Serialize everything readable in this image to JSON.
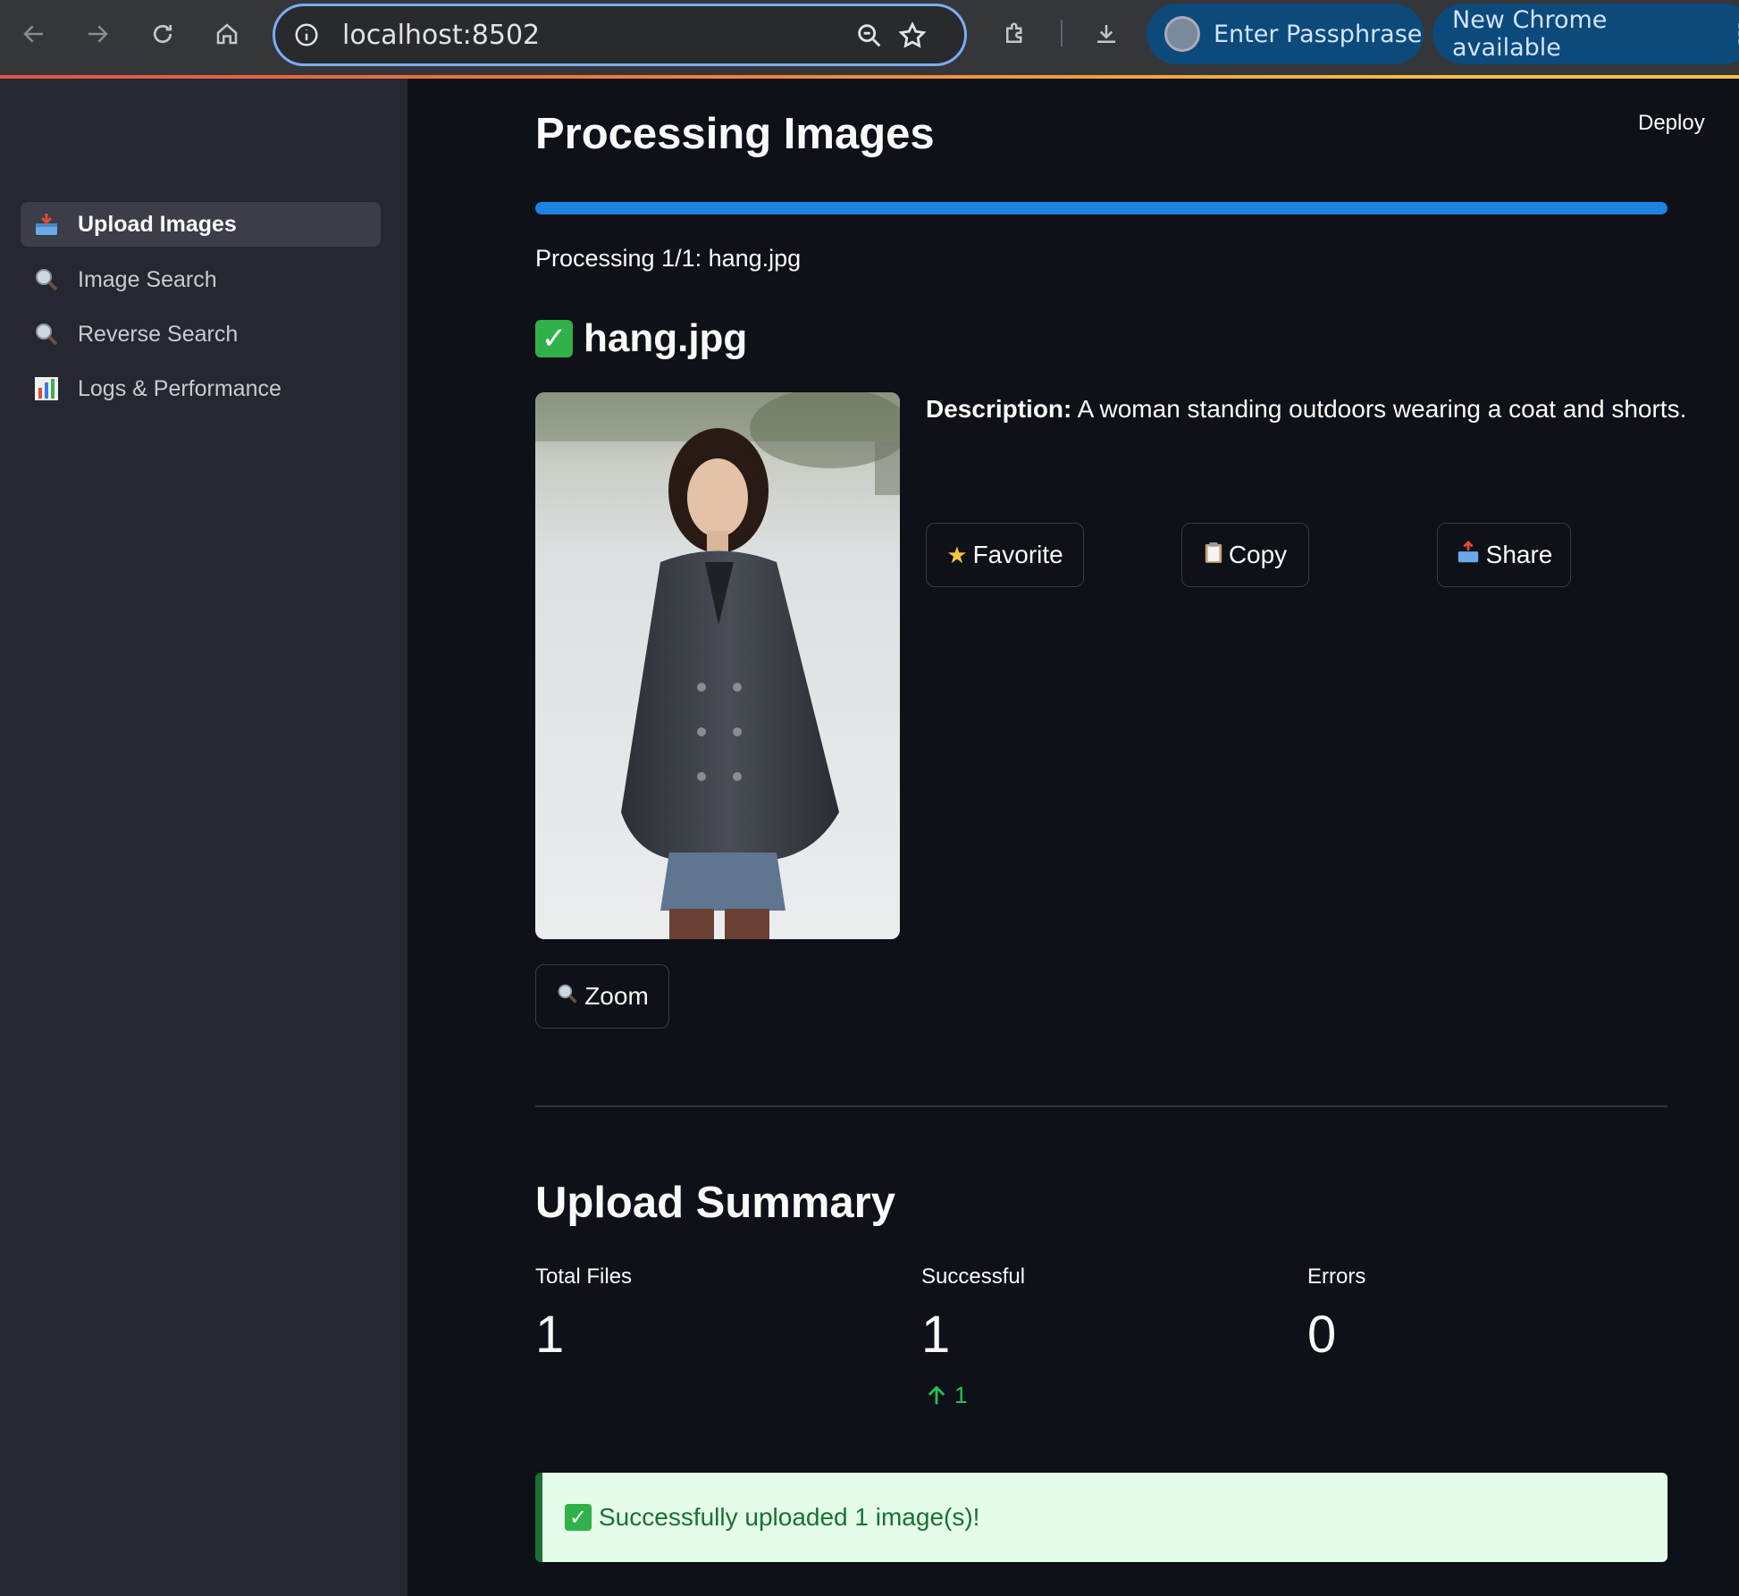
{
  "browser": {
    "url": "localhost:8502",
    "passphrase_label": "Enter Passphrase",
    "update_label": "New Chrome available"
  },
  "sidebar": {
    "items": [
      {
        "label": "Upload Images",
        "icon": "inbox-tray-icon"
      },
      {
        "label": "Image Search",
        "icon": "magnifier-icon"
      },
      {
        "label": "Reverse Search",
        "icon": "magnifier-icon"
      },
      {
        "label": "Logs & Performance",
        "icon": "bar-chart-icon"
      }
    ]
  },
  "header": {
    "deploy_label": "Deploy"
  },
  "main": {
    "title": "Processing Images",
    "progress": 1.0,
    "progress_text": "Processing 1/1: hang.jpg",
    "file_name": "hang.jpg",
    "description_label": "Description:",
    "description": " A woman standing outdoors wearing a coat and shorts.",
    "buttons": {
      "favorite": "Favorite",
      "copy": "Copy",
      "share": "Share",
      "zoom": "Zoom"
    }
  },
  "summary": {
    "title": "Upload Summary",
    "metrics": [
      {
        "label": "Total Files",
        "value": "1"
      },
      {
        "label": "Successful",
        "value": "1",
        "delta": "1"
      },
      {
        "label": "Errors",
        "value": "0"
      }
    ],
    "success_message": "Successfully uploaded 1 image(s)!"
  },
  "colors": {
    "accent": "#1c83e1",
    "success": "#21c354",
    "alert_bg": "#e5fce9"
  }
}
